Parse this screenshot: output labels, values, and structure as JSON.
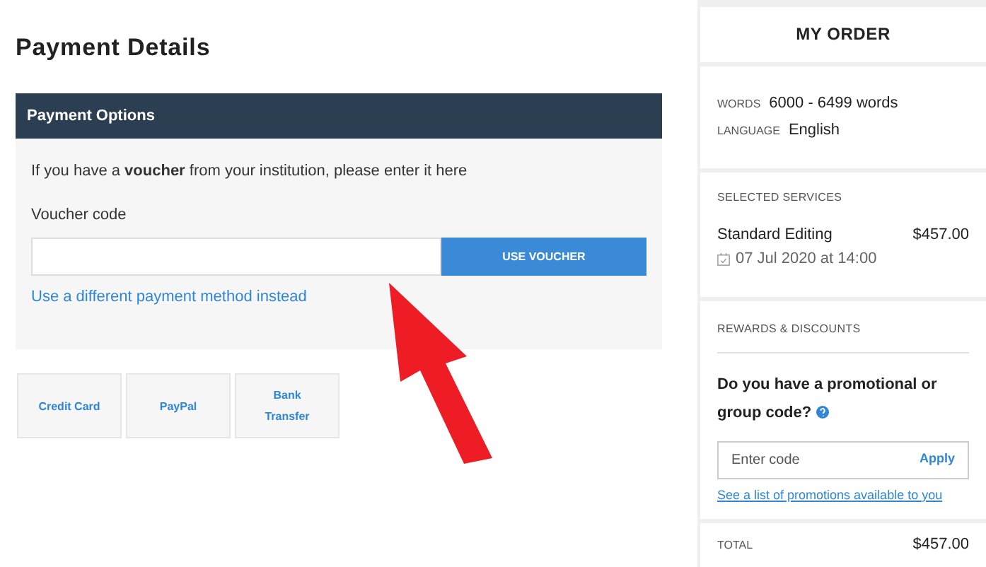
{
  "page_title": "Payment Details",
  "payment_options": {
    "header": "Payment Options",
    "intro": "If you have a **voucher** from your institution, please enter it here",
    "field_label": "Voucher code",
    "button": "USE VOUCHER",
    "link": "Use a different payment method instead"
  },
  "methods": [
    "Credit Card",
    "PayPal",
    "Bank Transfer"
  ],
  "order": {
    "title": "MY ORDER",
    "details": [
      {
        "label": "WORDS",
        "value": "6000 - 6499 words"
      },
      {
        "label": "LANGUAGE",
        "value": "English"
      }
    ],
    "services_heading": "SELECTED SERVICES",
    "service": {
      "name": "Standard Editing",
      "price": "$457.00",
      "date": "07 Jul 2020 at 14:00"
    },
    "rewards_heading": "REWARDS & DISCOUNTS",
    "promo_question": "Do you have a promotional or group code?",
    "promo_placeholder": "Enter code",
    "apply": "Apply",
    "promo_link": "See a list of promotions available to you",
    "total_label": "TOTAL",
    "total": "$457.00"
  }
}
